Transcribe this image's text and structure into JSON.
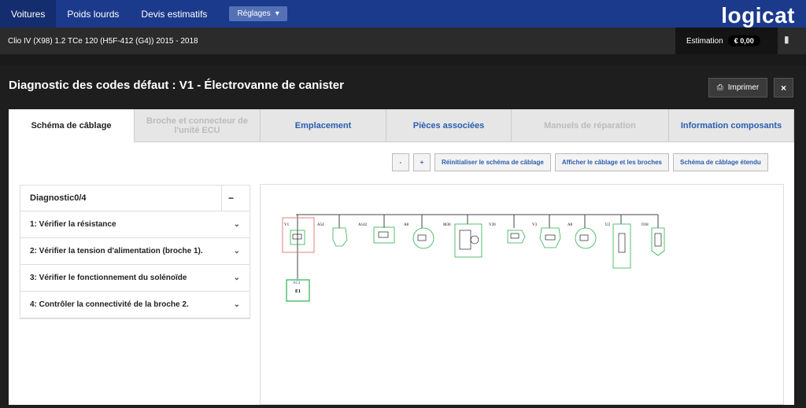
{
  "topnav": {
    "items": [
      "Voitures",
      "Poids lourds",
      "Devis estimatifs"
    ],
    "reglages": "Réglages",
    "logo": "logicat"
  },
  "vehicle": "Clio IV (X98) 1.2 TCe 120 (H5F-412 (G4)) 2015 - 2018",
  "estimation": {
    "label": "Estimation",
    "currency": "€",
    "value": "0,00"
  },
  "page": {
    "title": "Diagnostic des codes défaut : V1 - Électrovanne de canister",
    "print": "Imprimer",
    "close": "×"
  },
  "tabs": [
    {
      "label": "Schéma de câblage",
      "state": "active"
    },
    {
      "label": "Broche et connecteur de l'unité ECU",
      "state": "disabled"
    },
    {
      "label": "Emplacement",
      "state": "normal"
    },
    {
      "label": "Pièces associées",
      "state": "normal"
    },
    {
      "label": "Manuels de réparation",
      "state": "disabled"
    },
    {
      "label": "Information composants",
      "state": "normal"
    }
  ],
  "toolbar": {
    "minus": "-",
    "plus": "+",
    "reset": "Réinitialiser le schéma de câblage",
    "show": "Afficher le câblage et les broches",
    "extended": "Schéma de câblage étendu"
  },
  "diagnostic": {
    "title": "Diagnostic0/4",
    "steps": [
      "1: Vérifier la résistance",
      "2: Vérifier la tension d'alimentation (broche 1).",
      "3: Vérifier le fonctionnement du solénoïde",
      "4: Contrôler la connectivité de la broche 2."
    ]
  },
  "wiring": {
    "components": [
      "V1",
      "A54",
      "A142",
      "A8",
      "M36",
      "V20",
      "V3",
      "A8",
      "U2",
      "O18"
    ],
    "fuse_label": "AC4",
    "fuse_code": "E1"
  },
  "colors": {
    "nav": "#1b3a8c",
    "accent": "#2a5db0",
    "wire_green": "#2bb24c"
  }
}
